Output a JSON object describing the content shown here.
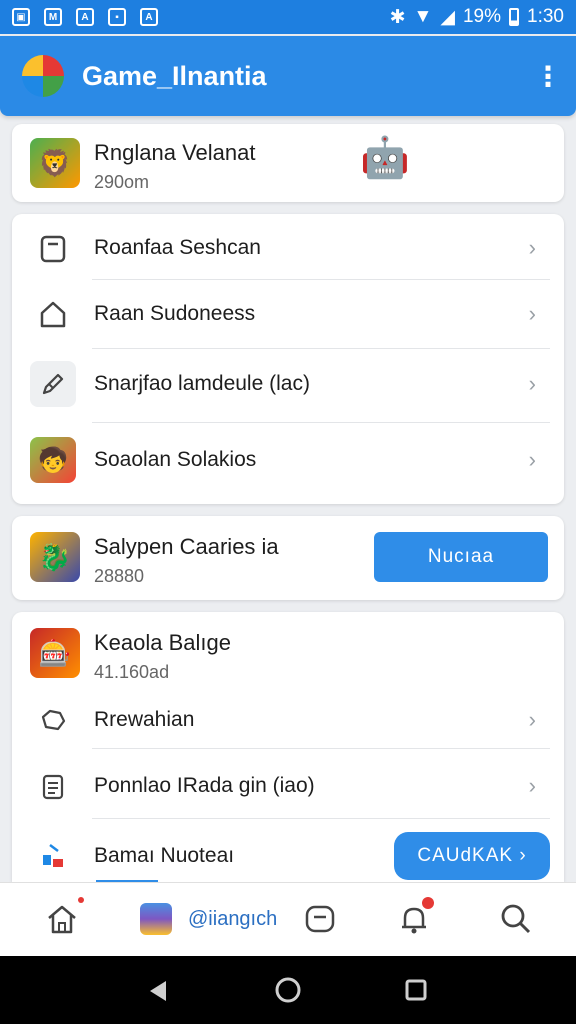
{
  "status_bar": {
    "battery": "19%",
    "time": "1:30"
  },
  "app_bar": {
    "title": "Game_Ilnantia"
  },
  "featured": {
    "title": "Rnglana Velanat",
    "subtitle": "290om"
  },
  "menu": [
    {
      "label": "Roanfaa Seshcan",
      "icon": "calendar-icon"
    },
    {
      "label": "Raan Sudoneess",
      "icon": "home-icon"
    },
    {
      "label": "Snarjfao lamdeule (lac)",
      "icon": "pencil-icon"
    },
    {
      "label": "Soaolan Solakios",
      "icon": "character-icon"
    }
  ],
  "promo": {
    "title": "Salypen Caaries ia",
    "subtitle": "28880",
    "button": "Nucıaa"
  },
  "section": {
    "title": "Keaola Balıge",
    "subtitle": "41.160ad",
    "items": [
      {
        "label": "Rrewahian",
        "icon": "wallet-icon"
      },
      {
        "label": "Ponnlao IRada gin (iao)",
        "icon": "clipboard-icon"
      }
    ],
    "last": {
      "label": "Bamaı Nuoteaı",
      "button": "CAUdKAK ›"
    }
  },
  "bottom_nav": {
    "center_label": "@iiangıch"
  },
  "colors": {
    "primary": "#2b8ae6",
    "button": "#2f8de8"
  }
}
